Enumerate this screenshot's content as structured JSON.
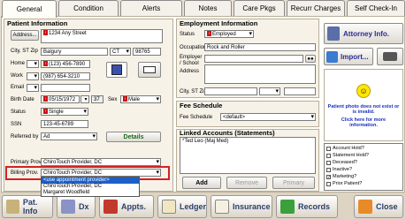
{
  "tabs": [
    "General",
    "Condition",
    "Alerts",
    "Notes",
    "Care Pkgs",
    "Recurr Charges",
    "Self Check-In"
  ],
  "patient": {
    "section": "Patient Information",
    "address_btn": "Address...",
    "address1": "1234 Any Street",
    "city_label": "City, ST Zip",
    "city": "Balgury",
    "state": "CT",
    "zip": "98765",
    "home_label": "Home",
    "home": "(123) 456-7890",
    "work_label": "Work",
    "work": "(987) 654-3210",
    "email_label": "Email",
    "birth_label": "Birth Date",
    "birth": "05/15/1972",
    "age": "37",
    "sex_label": "Sex",
    "sex": "Male",
    "status_label": "Status",
    "status": "Single",
    "ssn_label": "SSN",
    "ssn": "123-45-6789",
    "ref_label": "Referred by",
    "ref": "Ad",
    "details_btn": "Details",
    "primary_label": "Primary Prov.",
    "primary": "ChiroTouch Provider, DC",
    "billing_label": "Billing Prov.",
    "billing": "ChiroTouch Provider, DC",
    "billing_options": [
      "<use appointment provider>",
      "ChiroTouch Provider, DC",
      "Margaret Woodfield"
    ]
  },
  "employment": {
    "section": "Employment Information",
    "status_label": "Status",
    "status": "Employed",
    "occ_label": "Occupation",
    "occ": "Rock and Roller",
    "emp_label": "Employer / School",
    "addr_label": "Address",
    "city_label": "City, ST Zip"
  },
  "fee": {
    "section": "Fee Schedule",
    "label": "Fee Schedule",
    "value": "<default>"
  },
  "linked": {
    "section": "Linked Accounts (Statements)",
    "entry": "*Ted Leo (Maj Med)",
    "add": "Add",
    "remove": "Remove",
    "primary": "Primary"
  },
  "side": {
    "attorney": "Attorney Info.",
    "import": "Import...",
    "invalid": "Patient photo does not exist or is invalid.",
    "click_more": "Click here for more information.",
    "checks": [
      "Account Hold?",
      "Statement Hold?",
      "Deceased?",
      "Inactive?",
      "Marketing?",
      "Prior Patient?"
    ],
    "checked": [
      false,
      false,
      false,
      false,
      true,
      false
    ]
  },
  "bottom": [
    "Pat. Info",
    "Dx",
    "Appts.",
    "Ledger",
    "Insurance",
    "Records",
    "Close"
  ]
}
